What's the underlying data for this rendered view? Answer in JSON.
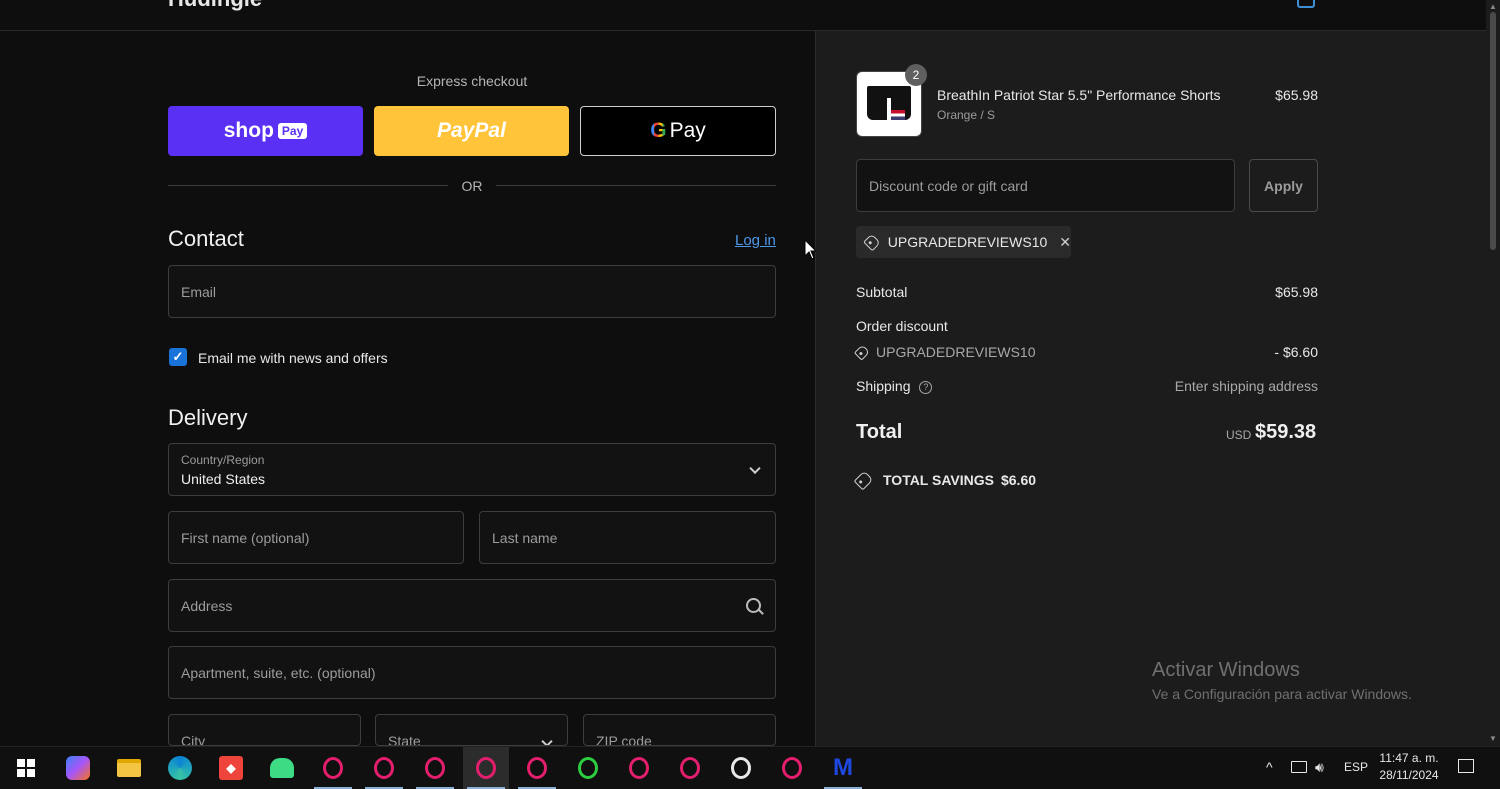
{
  "header": {
    "brand": "Hudingle"
  },
  "express": {
    "title": "Express checkout",
    "shop_label": "shop",
    "shop_badge": "Pay",
    "paypal_label": "PayPal",
    "gpay_g": "G",
    "gpay_label": "Pay",
    "or_label": "OR"
  },
  "contact": {
    "title": "Contact",
    "login_label": "Log in",
    "email_placeholder": "Email",
    "newsletter_label": "Email me with news and offers",
    "newsletter_checked": true
  },
  "delivery": {
    "title": "Delivery",
    "country_label": "Country/Region",
    "country_value": "United States",
    "first_name_placeholder": "First name (optional)",
    "last_name_placeholder": "Last name",
    "address_placeholder": "Address",
    "apartment_placeholder": "Apartment, suite, etc. (optional)",
    "city_placeholder": "City",
    "state_placeholder": "State",
    "zip_placeholder": "ZIP code"
  },
  "cart": {
    "item": {
      "quantity": "2",
      "name": "BreathIn Patriot Star 5.5\" Performance Shorts",
      "variant": "Orange / S",
      "price": "$65.98"
    },
    "discount_placeholder": "Discount code or gift card",
    "apply_label": "Apply",
    "applied_code": "UPGRADEDREVIEWS10"
  },
  "summary": {
    "subtotal_label": "Subtotal",
    "subtotal_value": "$65.98",
    "order_discount_label": "Order discount",
    "discount_code": "UPGRADEDREVIEWS10",
    "discount_value": "- $6.60",
    "shipping_label": "Shipping",
    "shipping_value": "Enter shipping address",
    "total_label": "Total",
    "total_currency": "USD",
    "total_value": "$59.38",
    "savings_label": "TOTAL SAVINGS",
    "savings_value": "$6.60"
  },
  "watermark": {
    "title": "Activar Windows",
    "subtitle": "Ve a Configuración para activar Windows."
  },
  "taskbar": {
    "language": "ESP",
    "time": "11:47 a. m.",
    "date": "28/11/2024"
  },
  "colors": {
    "accent_link": "#4e97e8",
    "shop_pay": "#5a31f4",
    "paypal": "#ffc439",
    "checkbox": "#1a73d9"
  }
}
